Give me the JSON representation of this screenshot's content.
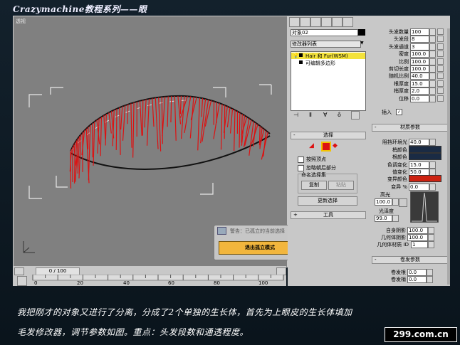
{
  "title": "Crazymachine教程系列——眼",
  "viewport": {
    "label": "透视"
  },
  "dialog": {
    "title": "警告：已孤立的当前选择",
    "button": "退出孤立模式"
  },
  "timeline": {
    "slider": "0 / 100",
    "ticks": [
      "0",
      "20",
      "40",
      "60",
      "80",
      "100"
    ]
  },
  "panel": {
    "object_name": "对象02",
    "modifier_list": "修改器列表",
    "stack": [
      "Hair 和 Fur(WSM)",
      "可编辑多边形"
    ],
    "selection": {
      "header": "选择",
      "by_vertex": "按照顶点",
      "ignore_back": "忽略朝后部分",
      "named_sets": "命名选择集",
      "copy": "复制",
      "paste": "粘贴",
      "update": "更新选择"
    },
    "tools_header": "工具",
    "params": [
      {
        "label": "头发数量",
        "value": "100"
      },
      {
        "label": "头发段",
        "value": "8"
      },
      {
        "label": "头发通道",
        "value": "3"
      },
      {
        "label": "密度",
        "value": "100.0"
      },
      {
        "label": "比例",
        "value": "100.0"
      },
      {
        "label": "剪切长度",
        "value": "100.0"
      },
      {
        "label": "随机比例",
        "value": "40.0"
      },
      {
        "label": "根厚度",
        "value": "15.0"
      },
      {
        "label": "梢厚度",
        "value": "2.0"
      },
      {
        "label": "位移",
        "value": "0.0"
      }
    ],
    "interpolate": "插入",
    "material": {
      "header": "材质参数",
      "occlusion_label": "阻挡环境光",
      "occlusion_value": "40.0",
      "tip_color": "梢颜色",
      "root_color": "根颜色",
      "hue_var_label": "色调变化",
      "hue_var_value": "15.0",
      "val_var_label": "值变化",
      "val_var_value": "50.0",
      "mutant_color": "变异颜色",
      "mutant_label": "变异 %",
      "mutant_value": "0.0",
      "spec_label": "高光",
      "spec_value": "100.0",
      "gloss_label": "光泽度",
      "gloss_value": "99.0",
      "self_shadow_label": "自身阴影",
      "self_shadow_value": "100.0",
      "geom_shadow_label": "几何体阴影",
      "geom_shadow_value": "100.0",
      "geom_mat_label": "几何体材质 ID",
      "geom_mat_value": "1"
    },
    "curl": {
      "header": "卷发参数",
      "root_label": "卷发根",
      "root_value": "0.0",
      "tip_label": "卷发梢",
      "tip_value": "0.0"
    }
  },
  "caption": {
    "line1": "我把刚才的对象又进行了分离，分成了2个单独的生长体，首先为上眼皮的生长体填加",
    "line2": "毛发修改器，调节参数如图。重点：头发段数和通透程度。"
  },
  "watermark": "299.com.cn"
}
